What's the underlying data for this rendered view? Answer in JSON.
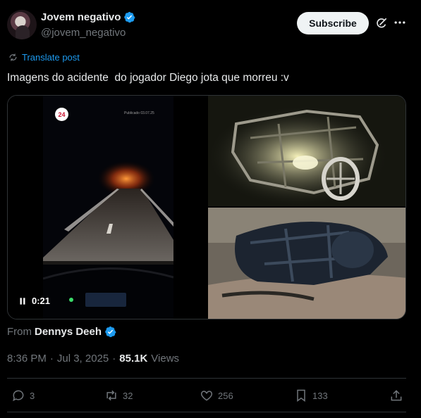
{
  "author": {
    "display_name": "Jovem negativo",
    "handle": "@jovem_negativo"
  },
  "header": {
    "subscribe_label": "Subscribe"
  },
  "translate": {
    "label": "Translate post"
  },
  "post": {
    "text": "Imagens do acidente  do jogador Diego jota que morreu :v"
  },
  "video": {
    "time": "0:21",
    "logo_text": "24",
    "overlay_text": "Publicado 03.07.25"
  },
  "attribution": {
    "from_label": "From",
    "from_name": "Dennys Deeh"
  },
  "meta": {
    "time": "8:36 PM",
    "date": "Jul 3, 2025",
    "views_count": "85.1K",
    "views_label": "Views"
  },
  "actions": {
    "replies": "3",
    "reposts": "32",
    "likes": "256",
    "bookmarks": "133"
  },
  "colors": {
    "accent": "#1d9bf0",
    "background": "#000000",
    "muted_text": "#71767b",
    "text": "#e7e9ea",
    "divider": "#2f3336"
  },
  "icons": [
    "verified-badge-icon",
    "grok-icon",
    "more-icon",
    "translate-icon",
    "pause-icon",
    "reply-icon",
    "repost-icon",
    "like-icon",
    "bookmark-icon",
    "share-icon"
  ]
}
